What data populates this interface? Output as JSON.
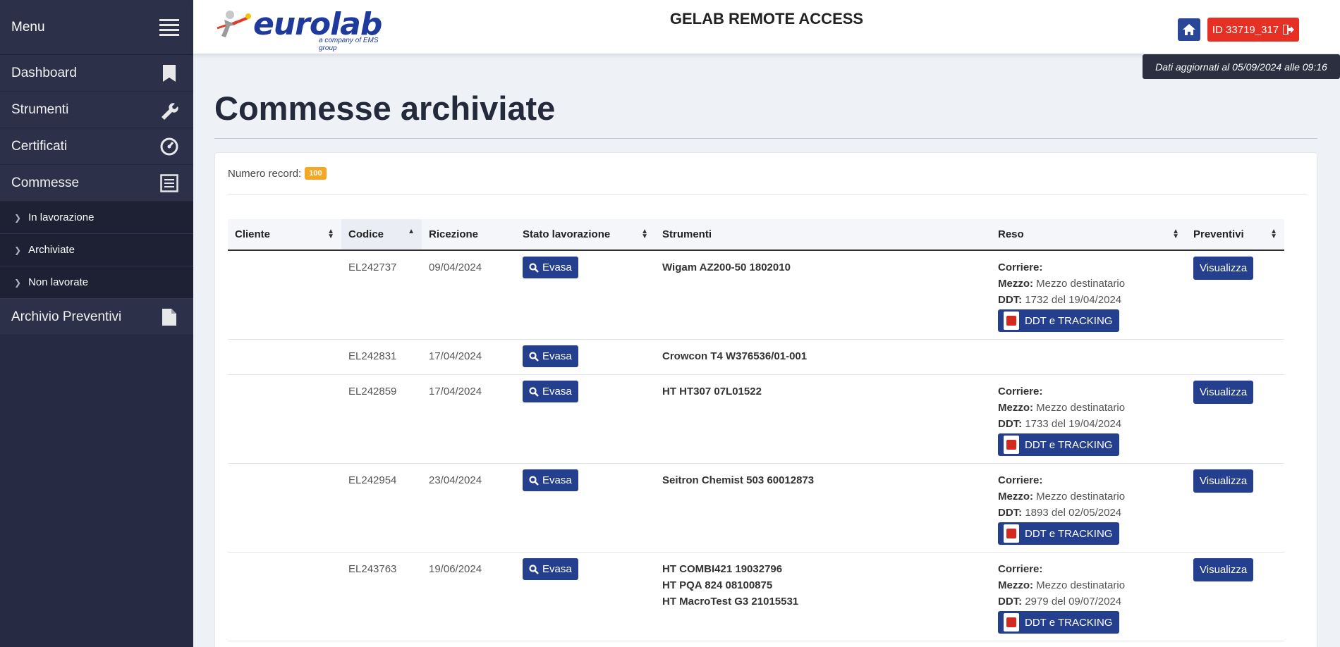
{
  "sidebar": {
    "menu_label": "Menu",
    "items": [
      {
        "label": "Dashboard",
        "icon": "bookmark-icon"
      },
      {
        "label": "Strumenti",
        "icon": "wrench-icon"
      },
      {
        "label": "Certificati",
        "icon": "gauge-icon"
      },
      {
        "label": "Commesse",
        "icon": "list-icon"
      }
    ],
    "subitems": [
      {
        "label": "In lavorazione"
      },
      {
        "label": "Archiviate"
      },
      {
        "label": "Non lavorate"
      }
    ],
    "last_item": {
      "label": "Archivio Preventivi",
      "icon": "document-icon"
    }
  },
  "header": {
    "logo_word": "eurolab",
    "logo_tagline": "a company of EMS group",
    "app_title": "GELAB REMOTE ACCESS",
    "user_id": "ID 33719_317",
    "tooltip": "Dati aggiornati al 05/09/2024 alle 09:16"
  },
  "main": {
    "page_title": "Commesse archiviate",
    "records_label": "Numero record:",
    "records_count": "100",
    "columns": [
      "Cliente",
      "Codice",
      "Ricezione",
      "Stato lavorazione",
      "Strumenti",
      "Reso",
      "Preventivi"
    ],
    "status_label": "Evasa",
    "preview_label": "Visualizza",
    "ddt_button_label": "DDT e TRACKING",
    "reso_labels": {
      "corriere": "Corriere:",
      "mezzo": "Mezzo:",
      "ddt": "DDT:"
    },
    "rows": [
      {
        "cliente": "",
        "codice": "EL242737",
        "ricezione": "09/04/2024",
        "strumenti": [
          "Wigam AZ200-50 1802010"
        ],
        "mezzo": "Mezzo destinatario",
        "ddt": "1732 del 19/04/2024",
        "has_reso": true
      },
      {
        "cliente": "",
        "codice": "EL242831",
        "ricezione": "17/04/2024",
        "strumenti": [
          "Crowcon T4 W376536/01-001"
        ],
        "has_reso": false
      },
      {
        "cliente": "",
        "codice": "EL242859",
        "ricezione": "17/04/2024",
        "strumenti": [
          "HT HT307 07L01522"
        ],
        "mezzo": "Mezzo destinatario",
        "ddt": "1733 del 19/04/2024",
        "has_reso": true
      },
      {
        "cliente": "",
        "codice": "EL242954",
        "ricezione": "23/04/2024",
        "strumenti": [
          "Seitron Chemist 503 60012873"
        ],
        "mezzo": "Mezzo destinatario",
        "ddt": "1893 del 02/05/2024",
        "has_reso": true
      },
      {
        "cliente": "",
        "codice": "EL243763",
        "ricezione": "19/06/2024",
        "strumenti": [
          "HT COMBI421 19032796",
          "HT PQA 824 08100875",
          "HT MacroTest G3 21015531"
        ],
        "mezzo": "Mezzo destinatario",
        "ddt": "2979 del 09/07/2024",
        "has_reso": true
      }
    ]
  }
}
